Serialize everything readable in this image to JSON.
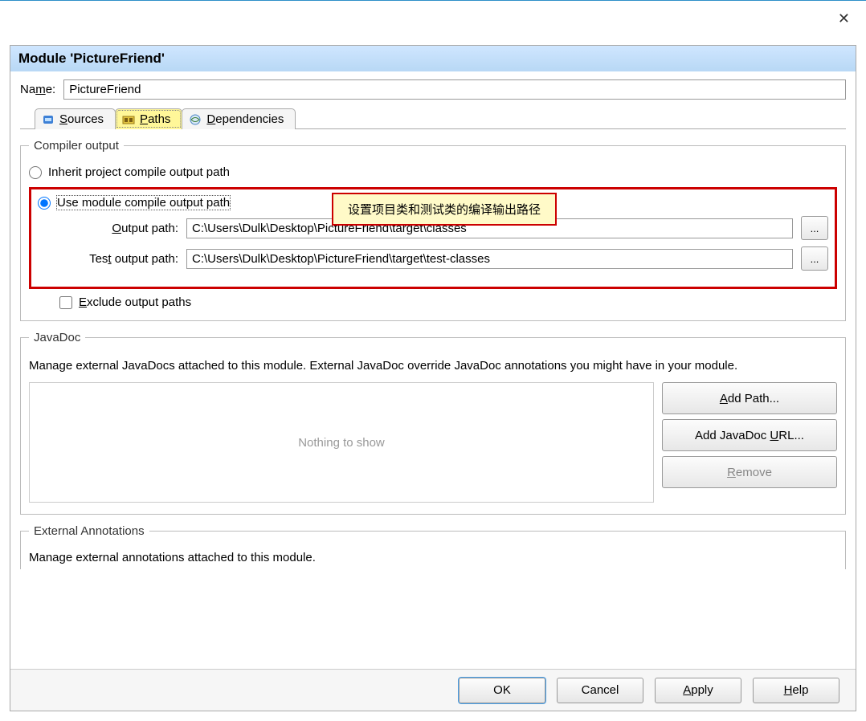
{
  "window": {
    "dialog_title": "Module 'PictureFriend'"
  },
  "name_row": {
    "label_prefix": "Na",
    "label_ul": "m",
    "label_suffix": "e:",
    "value": "PictureFriend"
  },
  "tabs": {
    "sources_prefix": " ",
    "sources_ul": "S",
    "sources_suffix": "ources",
    "paths_prefix": " ",
    "paths_ul": "P",
    "paths_suffix": "aths",
    "deps_prefix": " ",
    "deps_ul": "D",
    "deps_suffix": "ependencies"
  },
  "compiler": {
    "legend": "Compiler output",
    "inherit_label": "Inherit project compile output path",
    "use_module_label": "Use module compile output path",
    "output_label_prefix": "",
    "output_label_ul": "O",
    "output_label_suffix": "utput path:",
    "output_value": "C:\\Users\\Dulk\\Desktop\\PictureFriend\\target\\classes",
    "test_output_label_prefix": "Tes",
    "test_output_label_ul": "t",
    "test_output_label_suffix": " output path:",
    "test_output_value": "C:\\Users\\Dulk\\Desktop\\PictureFriend\\target\\test-classes",
    "browse": "...",
    "exclude_label_prefix": "",
    "exclude_label_ul": "E",
    "exclude_label_suffix": "xclude output paths"
  },
  "callout": {
    "text": "设置项目类和测试类的编译输出路径"
  },
  "javadoc": {
    "legend": "JavaDoc",
    "desc": "Manage external JavaDocs attached to this module. External JavaDoc override JavaDoc annotations you might have in your module.",
    "empty": "Nothing to show",
    "add_path_ul": "A",
    "add_path_suffix": "dd Path...",
    "add_url_prefix": "Add JavaDoc ",
    "add_url_ul": "U",
    "add_url_suffix": "RL...",
    "remove_ul": "R",
    "remove_suffix": "emove"
  },
  "external_annotations": {
    "legend": "External Annotations",
    "desc": "Manage external annotations attached to this module."
  },
  "buttons": {
    "ok": "OK",
    "cancel": "Cancel",
    "apply_ul": "A",
    "apply_suffix": "pply",
    "help_ul": "H",
    "help_suffix": "elp"
  }
}
